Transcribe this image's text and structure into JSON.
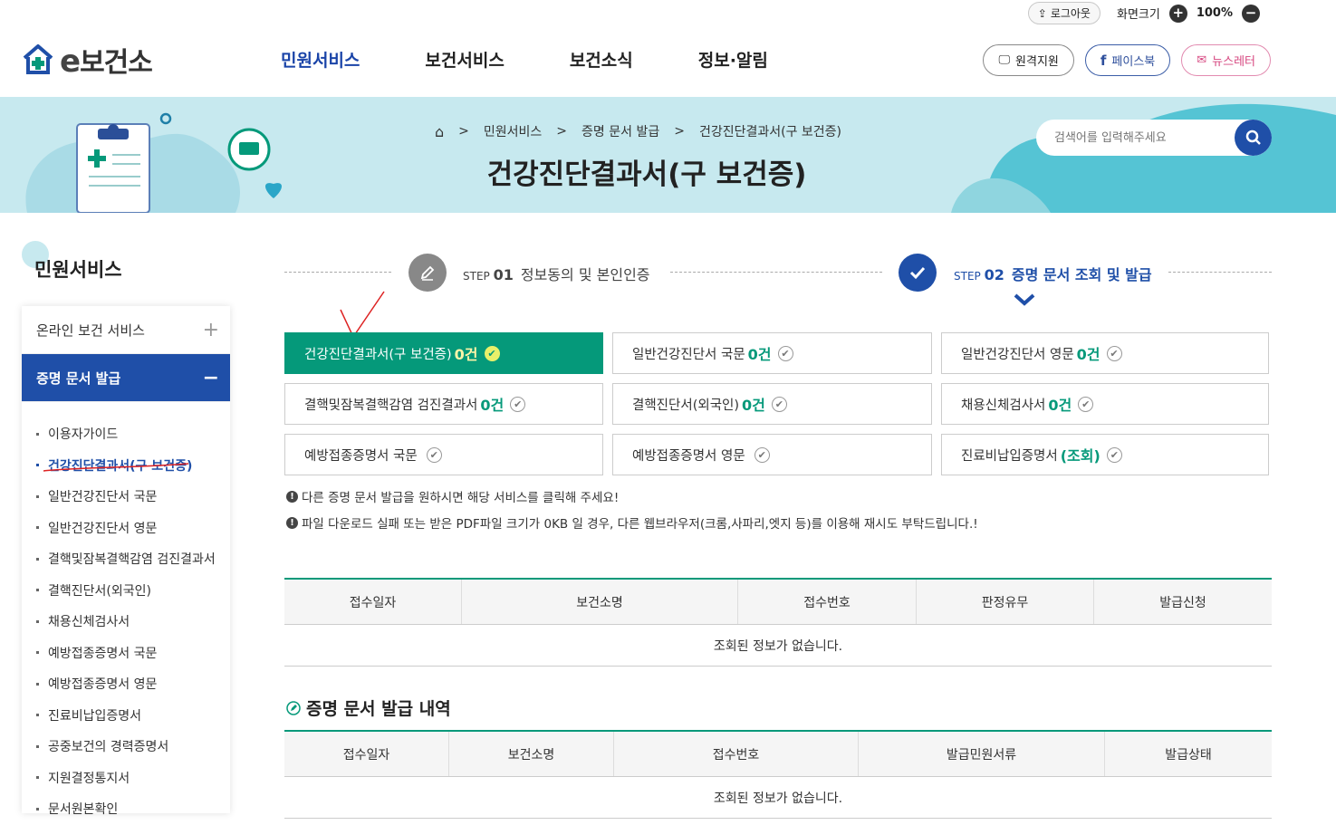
{
  "util": {
    "logout": "로그아웃",
    "zoom_label": "화면크기",
    "zoom": "100%"
  },
  "logo": {
    "prefix": "e",
    "name": "보건소"
  },
  "gnb": [
    "민원서비스",
    "보건서비스",
    "보건소식",
    "정보·알림"
  ],
  "header_btns": {
    "remote": "원격지원",
    "facebook": "페이스북",
    "newsletter": "뉴스레터"
  },
  "breadcrumb": [
    "민원서비스",
    "증명 문서 발급",
    "건강진단결과서(구 보건증)"
  ],
  "page_title": "건강진단결과서(구 보건증)",
  "search": {
    "placeholder": "검색어를 입력해주세요"
  },
  "lnb": {
    "title": "민원서비스",
    "groups": [
      {
        "label": "온라인 보건 서비스",
        "sign": "+"
      },
      {
        "label": "증명 문서 발급",
        "sign": "−"
      }
    ],
    "items": [
      "이용자가이드",
      "건강진단결과서(구 보건증)",
      "일반건강진단서 국문",
      "일반건강진단서 영문",
      "결핵및잠복결핵감염 검진결과서",
      "결핵진단서(외국인)",
      "채용신체검사서",
      "예방접종증명서 국문",
      "예방접종증명서 영문",
      "진료비납입증명서",
      "공중보건의 경력증명서",
      "지원결정통지서",
      "문서원본확인"
    ]
  },
  "steps": [
    {
      "prefix": "STEP",
      "no": "01",
      "label": "정보동의 및 본인인증"
    },
    {
      "prefix": "STEP",
      "no": "02",
      "label": "증명 문서 조회 및 발급"
    }
  ],
  "docs": [
    {
      "name": "건강진단결과서(구 보건증)",
      "count": "0건"
    },
    {
      "name": "일반건강진단서 국문",
      "count": "0건"
    },
    {
      "name": "일반건강진단서 영문",
      "count": "0건"
    },
    {
      "name": "결핵및잠복결핵감염 검진결과서",
      "count": "0건"
    },
    {
      "name": "결핵진단서(외국인)",
      "count": "0건"
    },
    {
      "name": "채용신체검사서",
      "count": "0건"
    },
    {
      "name": "예방접종증명서 국문",
      "count": ""
    },
    {
      "name": "예방접종증명서 영문",
      "count": ""
    },
    {
      "name": "진료비납입증명서",
      "count": "(조회)"
    }
  ],
  "notices": [
    "다른 증명 문서 발급을 원하시면 해당 서비스를 클릭해 주세요!",
    "파일 다운로드 실패 또는 받은 PDF파일 크기가 0KB 일 경우, 다른 웹브라우저(크롬,사파리,엣지 등)를 이용해 재시도 부탁드립니다.!"
  ],
  "table1": {
    "headers": [
      "접수일자",
      "보건소명",
      "접수번호",
      "판정유무",
      "발급신청"
    ],
    "empty": "조회된 정보가 없습니다."
  },
  "section2_title": "증명 문서 발급 내역",
  "table2": {
    "headers": [
      "접수일자",
      "보건소명",
      "접수번호",
      "발급민원서류",
      "발급상태"
    ],
    "empty": "조회된 정보가 없습니다."
  },
  "colors": {
    "primary": "#1f4fa8",
    "green": "#05997a",
    "banner": "#c7e9ef"
  }
}
